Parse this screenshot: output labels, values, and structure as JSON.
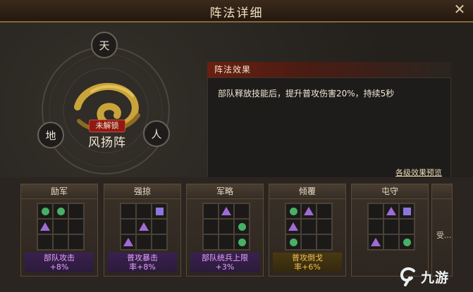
{
  "window": {
    "title": "阵法详细"
  },
  "formation": {
    "name": "风扬阵",
    "status_badge": "未解锁",
    "nodes": [
      {
        "glyph": "天",
        "name": "top"
      },
      {
        "glyph": "地",
        "name": "left"
      },
      {
        "glyph": "人",
        "name": "right"
      }
    ]
  },
  "effect": {
    "header": "阵法效果",
    "description": "部队释放技能后，提升普攻伤害20%，持续5秒",
    "preview_link": "各级效果预览"
  },
  "cards": [
    {
      "title": "励军",
      "grid": [
        "circle",
        "circle",
        "",
        "triangle",
        "",
        "",
        "",
        "",
        ""
      ],
      "bonus": "部队攻击\n+8%",
      "bonus_color": "#e7a2ff",
      "gold": false
    },
    {
      "title": "强掠",
      "grid": [
        "",
        "",
        "square",
        "",
        "triangle",
        "",
        "triangle",
        "",
        ""
      ],
      "bonus": "普攻暴击\n率+8%",
      "bonus_color": "#e7a2ff",
      "gold": false
    },
    {
      "title": "军略",
      "grid": [
        "",
        "triangle",
        "",
        "",
        "",
        "circle",
        "",
        "",
        "circle"
      ],
      "bonus": "部队统兵上限\n+3%",
      "bonus_color": "#e7a2ff",
      "gold": false
    },
    {
      "title": "倾覆",
      "grid": [
        "circle",
        "triangle",
        "",
        "triangle",
        "",
        "",
        "circle",
        "",
        ""
      ],
      "bonus": "普攻倒戈\n率+6%",
      "bonus_color": "#f3c04a",
      "gold": true
    },
    {
      "title": "屯守",
      "grid": [
        "",
        "triangle",
        "square",
        "",
        "",
        "",
        "triangle",
        "",
        "circle"
      ],
      "bonus": "",
      "bonus_color": "#e7a2ff",
      "gold": false
    }
  ],
  "partial_card": {
    "text": "受..."
  },
  "watermark": {
    "text": "九游"
  },
  "colors": {
    "circle": "#47b064",
    "triangle": "#a06bd6",
    "square": "#8c77de",
    "accent_red": "#c8261c",
    "gold": "#e9c35c"
  }
}
